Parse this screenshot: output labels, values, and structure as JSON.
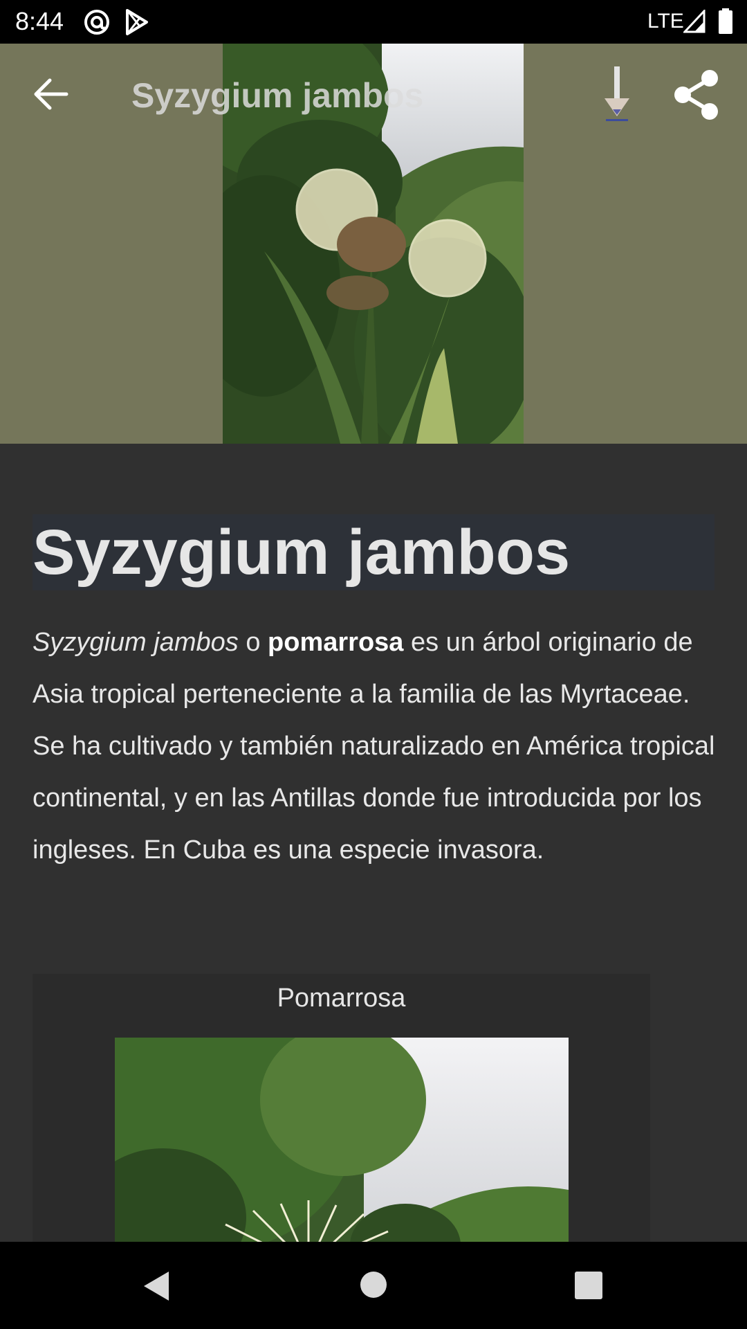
{
  "status_bar": {
    "time": "8:44",
    "network": "LTE",
    "icons": [
      "at-sign-icon",
      "play-store-icon",
      "signal-icon",
      "battery-icon"
    ]
  },
  "top_bar": {
    "title": "Syzygium jambos",
    "icons": [
      "back-arrow-icon",
      "download-icon",
      "share-icon"
    ]
  },
  "article": {
    "title": "Syzygium jambos",
    "intro_italic": "Syzygium jambos",
    "intro_connector": " o ",
    "intro_bold": "pomarrosa",
    "intro_rest": " es un árbol originario de Asia tropical perteneciente a la familia de las Myrtaceae. Se ha cultivado y también naturalizado en América tropical continental, y en las Antillas donde fue introducida por los ingleses. En Cuba es una especie invasora.",
    "infobox_caption": "Pomarrosa"
  },
  "nav_bar": {
    "icons": [
      "back-triangle-icon",
      "home-circle-icon",
      "recents-square-icon"
    ]
  },
  "colors": {
    "hero_background": "#75765a",
    "page_background": "#303030",
    "title_highlight": "#2d3138"
  }
}
